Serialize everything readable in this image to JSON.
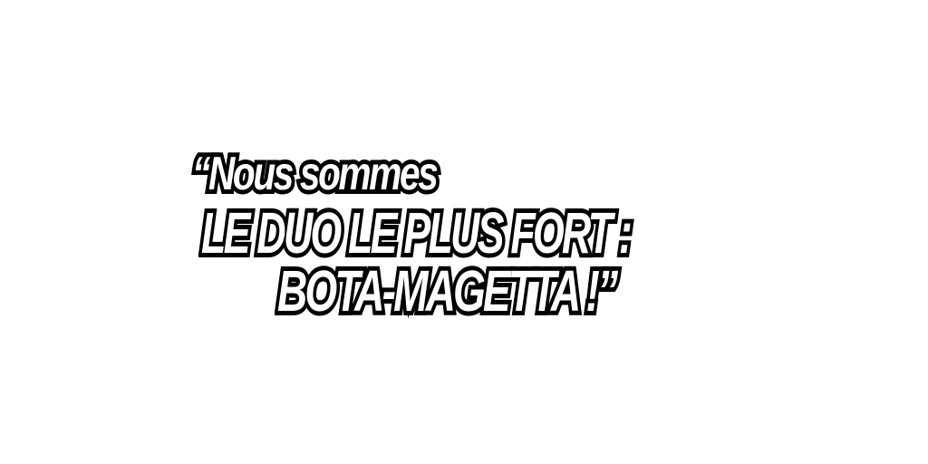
{
  "quote": {
    "line1": "“Nous sommes",
    "line2": "LE DUO LE PLUS FORT :",
    "line3": "BOTA-MAGETTA !”"
  },
  "colors": {
    "background": "#ffffff",
    "text_fill": "#ffffff",
    "text_outline": "#000000"
  }
}
